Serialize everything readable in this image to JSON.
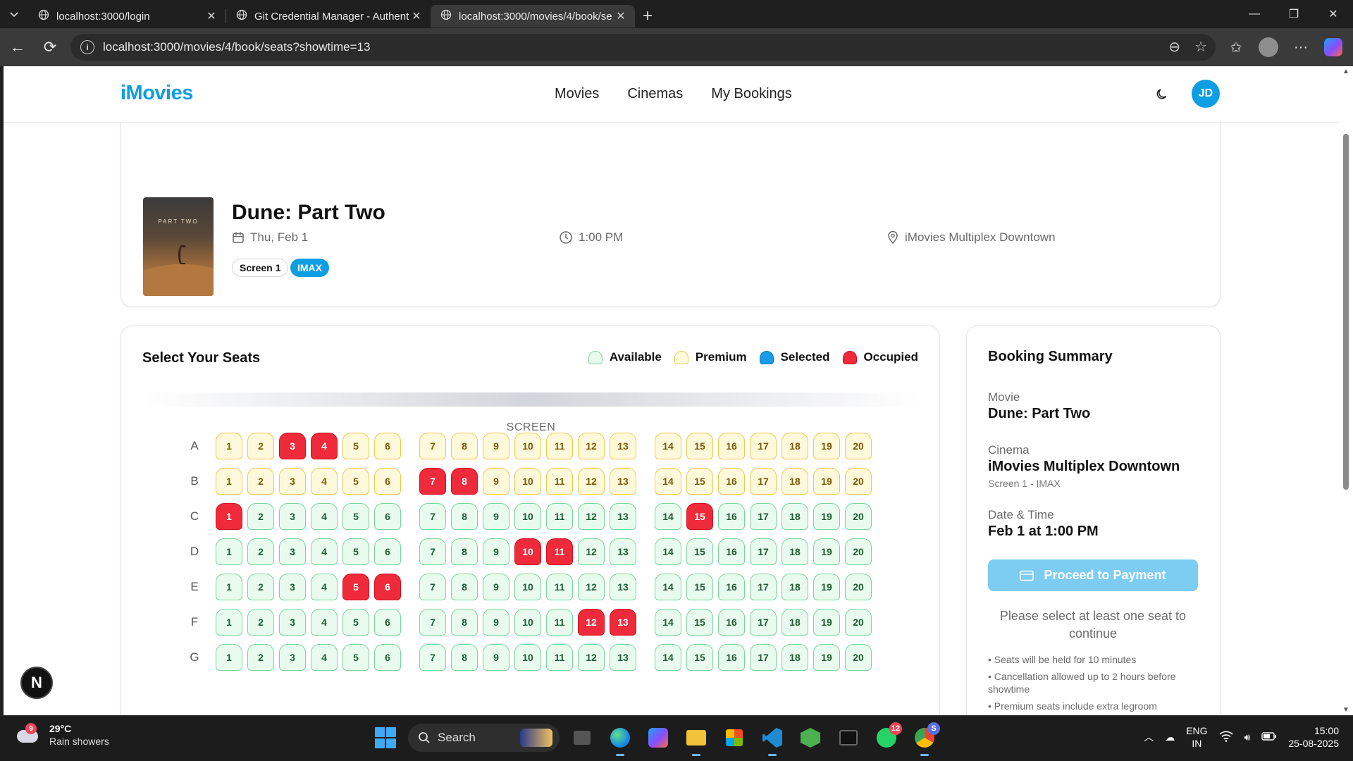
{
  "browser": {
    "tabs": [
      {
        "title": "localhost:3000/login",
        "active": false
      },
      {
        "title": "Git Credential Manager - Authent",
        "active": false
      },
      {
        "title": "localhost:3000/movies/4/book/se",
        "active": true
      }
    ],
    "url": "localhost:3000/movies/4/book/seats?showtime=13"
  },
  "header": {
    "logo": "iMovies",
    "nav": [
      "Movies",
      "Cinemas",
      "My Bookings"
    ],
    "avatar_initials": "JD"
  },
  "movie": {
    "title": "Dune: Part Two",
    "poster_text": "PART TWO",
    "date": "Thu, Feb 1",
    "time": "1:00 PM",
    "cinema": "iMovies Multiplex Downtown",
    "screen_tag": "Screen 1",
    "format_tag": "IMAX"
  },
  "seats": {
    "heading": "Select Your Seats",
    "legend": [
      {
        "label": "Available",
        "status": "available"
      },
      {
        "label": "Premium",
        "status": "premium"
      },
      {
        "label": "Selected",
        "status": "selected"
      },
      {
        "label": "Occupied",
        "status": "occupied"
      }
    ],
    "screen_label": "SCREEN",
    "rows": [
      {
        "label": "A",
        "type": "premium",
        "occupied": [
          3,
          4
        ]
      },
      {
        "label": "B",
        "type": "premium",
        "occupied": [
          7,
          8
        ]
      },
      {
        "label": "C",
        "type": "available",
        "occupied": [
          1,
          15
        ]
      },
      {
        "label": "D",
        "type": "available",
        "occupied": [
          10,
          11
        ]
      },
      {
        "label": "E",
        "type": "available",
        "occupied": [
          5,
          6
        ]
      },
      {
        "label": "F",
        "type": "available",
        "occupied": [
          12,
          13
        ]
      },
      {
        "label": "G",
        "type": "available",
        "occupied": []
      }
    ],
    "seats_per_row": 20
  },
  "summary": {
    "title": "Booking Summary",
    "movie_label": "Movie",
    "movie_value": "Dune: Part Two",
    "cinema_label": "Cinema",
    "cinema_value": "iMovies Multiplex Downtown",
    "cinema_sub": "Screen 1 - IMAX",
    "datetime_label": "Date & Time",
    "datetime_value": "Feb 1 at 1:00 PM",
    "pay_button": "Proceed to Payment",
    "hint": "Please select at least one seat to continue",
    "notes": [
      "• Seats will be held for 10 minutes",
      "• Cancellation allowed up to 2 hours before showtime",
      "• Premium seats include extra legroom"
    ]
  },
  "taskbar": {
    "weather_badge": "9",
    "temperature": "29°C",
    "condition": "Rain showers",
    "search_label": "Search",
    "whatsapp_count": "12",
    "chrome_badge": "S",
    "lang_top": "ENG",
    "lang_bottom": "IN",
    "time": "15:00",
    "date": "25-08-2025"
  },
  "colors": {
    "brand": "#0e9ee3",
    "available": "#e9fbef",
    "premium": "#fff9dc",
    "occupied": "#ef2b3b",
    "selected": "#1a9be6"
  }
}
